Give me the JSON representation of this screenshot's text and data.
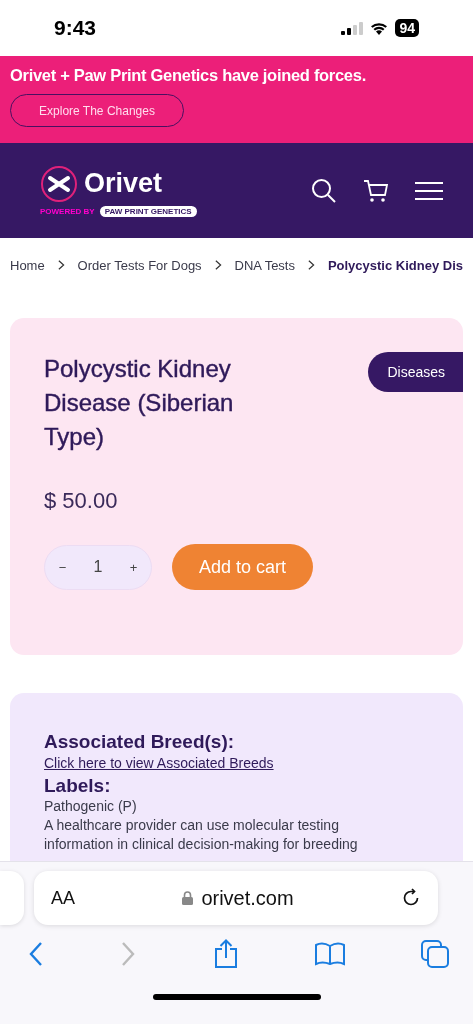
{
  "status_bar": {
    "time": "9:43",
    "battery": "94"
  },
  "promo_banner": {
    "text": "Orivet + Paw Print Genetics have joined forces.",
    "button": "Explore The Changes"
  },
  "header": {
    "brand": "Orivet",
    "powered_by": "POWERED BY",
    "partner": "PAW PRINT GENETICS"
  },
  "breadcrumb": [
    {
      "label": "Home",
      "current": false
    },
    {
      "label": "Order Tests For Dogs",
      "current": false
    },
    {
      "label": "DNA Tests",
      "current": false
    },
    {
      "label": "Polycystic Kidney Dis",
      "current": true
    }
  ],
  "product": {
    "title": "Polycystic Kidney Disease (Siberian Type)",
    "category": "Diseases",
    "price": "$ 50.00",
    "quantity": "1",
    "decrement": "−",
    "increment": "+",
    "add_button": "Add to cart"
  },
  "details": {
    "breeds_heading": "Associated Breed(s):",
    "breeds_link": "Click here to view Associated Breeds",
    "labels_heading": "Labels:",
    "label_name": "Pathogenic (P)",
    "label_description": "A healthcare provider can use molecular testing",
    "label_description_more": "information in clinical decision-making for breeding"
  },
  "browser": {
    "text_size": "AA",
    "url": "orivet.com",
    "back_disabled": false,
    "forward_disabled": true
  }
}
